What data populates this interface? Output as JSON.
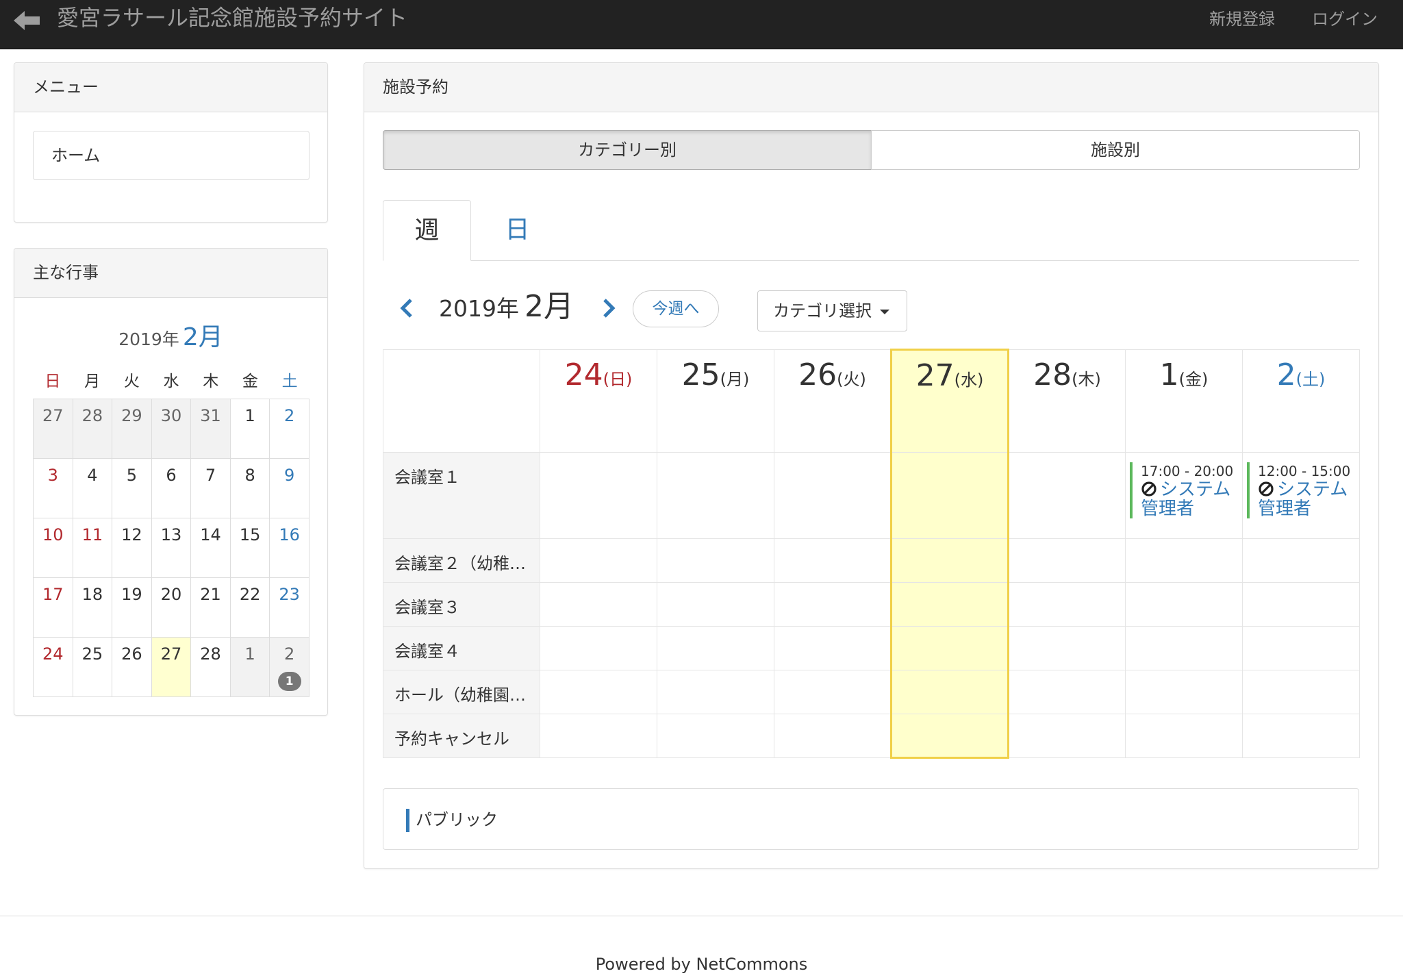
{
  "navbar": {
    "back_icon": "arrow-left-icon",
    "title": "愛宮ラサール記念館施設予約サイト",
    "register": "新規登録",
    "login": "ログイン"
  },
  "menu": {
    "heading": "メニュー",
    "items": [
      {
        "label": "ホーム"
      }
    ]
  },
  "events_panel": {
    "heading": "主な行事",
    "calendar": {
      "year": "2019年",
      "month": "2月",
      "weekdays": [
        "日",
        "月",
        "火",
        "水",
        "木",
        "金",
        "土"
      ],
      "weeks": [
        [
          {
            "d": "27",
            "other": true
          },
          {
            "d": "28",
            "other": true
          },
          {
            "d": "29",
            "other": true
          },
          {
            "d": "30",
            "other": true
          },
          {
            "d": "31",
            "other": true
          },
          {
            "d": "1"
          },
          {
            "d": "2"
          }
        ],
        [
          {
            "d": "3"
          },
          {
            "d": "4"
          },
          {
            "d": "5"
          },
          {
            "d": "6"
          },
          {
            "d": "7"
          },
          {
            "d": "8"
          },
          {
            "d": "9"
          }
        ],
        [
          {
            "d": "10"
          },
          {
            "d": "11",
            "holiday": true
          },
          {
            "d": "12"
          },
          {
            "d": "13"
          },
          {
            "d": "14"
          },
          {
            "d": "15"
          },
          {
            "d": "16"
          }
        ],
        [
          {
            "d": "17"
          },
          {
            "d": "18"
          },
          {
            "d": "19"
          },
          {
            "d": "20"
          },
          {
            "d": "21"
          },
          {
            "d": "22"
          },
          {
            "d": "23"
          }
        ],
        [
          {
            "d": "24"
          },
          {
            "d": "25"
          },
          {
            "d": "26"
          },
          {
            "d": "27",
            "today": true
          },
          {
            "d": "28"
          },
          {
            "d": "1",
            "other": true
          },
          {
            "d": "2",
            "other": true,
            "badge": "1"
          }
        ]
      ]
    }
  },
  "main": {
    "heading": "施設予約",
    "view_toggle": {
      "by_category": "カテゴリー別",
      "by_facility": "施設別",
      "active": "by_category"
    },
    "tabs": [
      {
        "label": "週",
        "active": true
      },
      {
        "label": "日",
        "active": false
      }
    ],
    "week_nav": {
      "year": "2019年",
      "month": "2月",
      "this_week": "今週へ",
      "category_select": "カテゴリ選択"
    },
    "days": [
      {
        "num": "24",
        "wd": "(日)",
        "type": "sun"
      },
      {
        "num": "25",
        "wd": "(月)",
        "type": "normal"
      },
      {
        "num": "26",
        "wd": "(火)",
        "type": "normal"
      },
      {
        "num": "27",
        "wd": "(水)",
        "type": "normal",
        "today": true
      },
      {
        "num": "28",
        "wd": "(木)",
        "type": "normal"
      },
      {
        "num": "1",
        "wd": "(金)",
        "type": "normal"
      },
      {
        "num": "2",
        "wd": "(土)",
        "type": "sat"
      }
    ],
    "rooms": [
      {
        "name": "会議室１"
      },
      {
        "name": "会議室２（幼稚…"
      },
      {
        "name": "会議室３"
      },
      {
        "name": "会議室４"
      },
      {
        "name": "ホール（幼稚園…"
      },
      {
        "name": "予約キャンセル"
      }
    ],
    "reservations": [
      {
        "room": 0,
        "day": 5,
        "time": "17:00 - 20:00",
        "icon": "ban-icon",
        "title": "システム管理者"
      },
      {
        "room": 0,
        "day": 6,
        "time": "12:00 - 15:00",
        "icon": "ban-icon",
        "title": "システム管理者"
      }
    ],
    "legend": {
      "label": "パブリック",
      "color": "#337ab7"
    }
  },
  "footer": {
    "text": "Powered by NetCommons"
  },
  "colors": {
    "sunday": "#b2292e",
    "saturday": "#337ab7",
    "today": "#ffffcc",
    "accent": "#337ab7"
  }
}
